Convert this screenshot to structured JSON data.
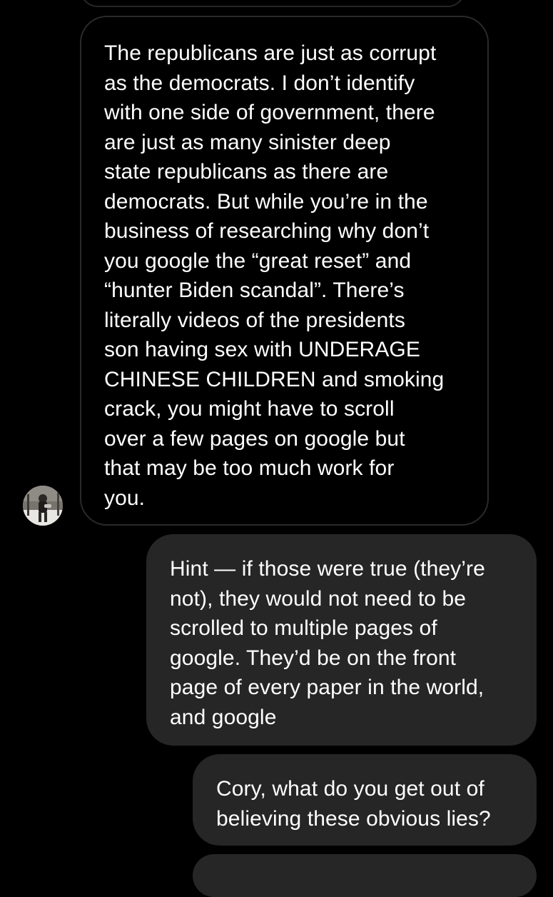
{
  "conversation": {
    "messages": [
      {
        "direction": "received",
        "text": "The republicans are just as corrupt\nas the democrats.  I don’t identify\nwith one side of government, there\nare just as many sinister deep\nstate republicans as there are\ndemocrats.  But while you’re in the\nbusiness of researching why don’t\nyou google the “great reset” and\n“hunter Biden scandal”.  There’s\nliterally videos of the presidents\nson having sex with UNDERAGE\nCHINESE CHILDREN and smoking\ncrack, you might have to scroll\nover a few pages on google but\nthat may be too much work for\nyou."
      },
      {
        "direction": "sent",
        "text": "Hint — if those were true (they’re\nnot), they would not need to be\nscrolled to multiple pages of\ngoogle. They’d be on the front\npage of every paper in the world,\nand google"
      },
      {
        "direction": "sent",
        "text": "Cory, what do you get out of\nbelieving these obvious lies?"
      }
    ]
  },
  "contact": {
    "avatar_icon": "profile-photo-avatar"
  },
  "colors": {
    "background": "#000000",
    "received_border": "#2a2a2a",
    "sent_bubble": "#262626",
    "text": "#ffffff"
  }
}
